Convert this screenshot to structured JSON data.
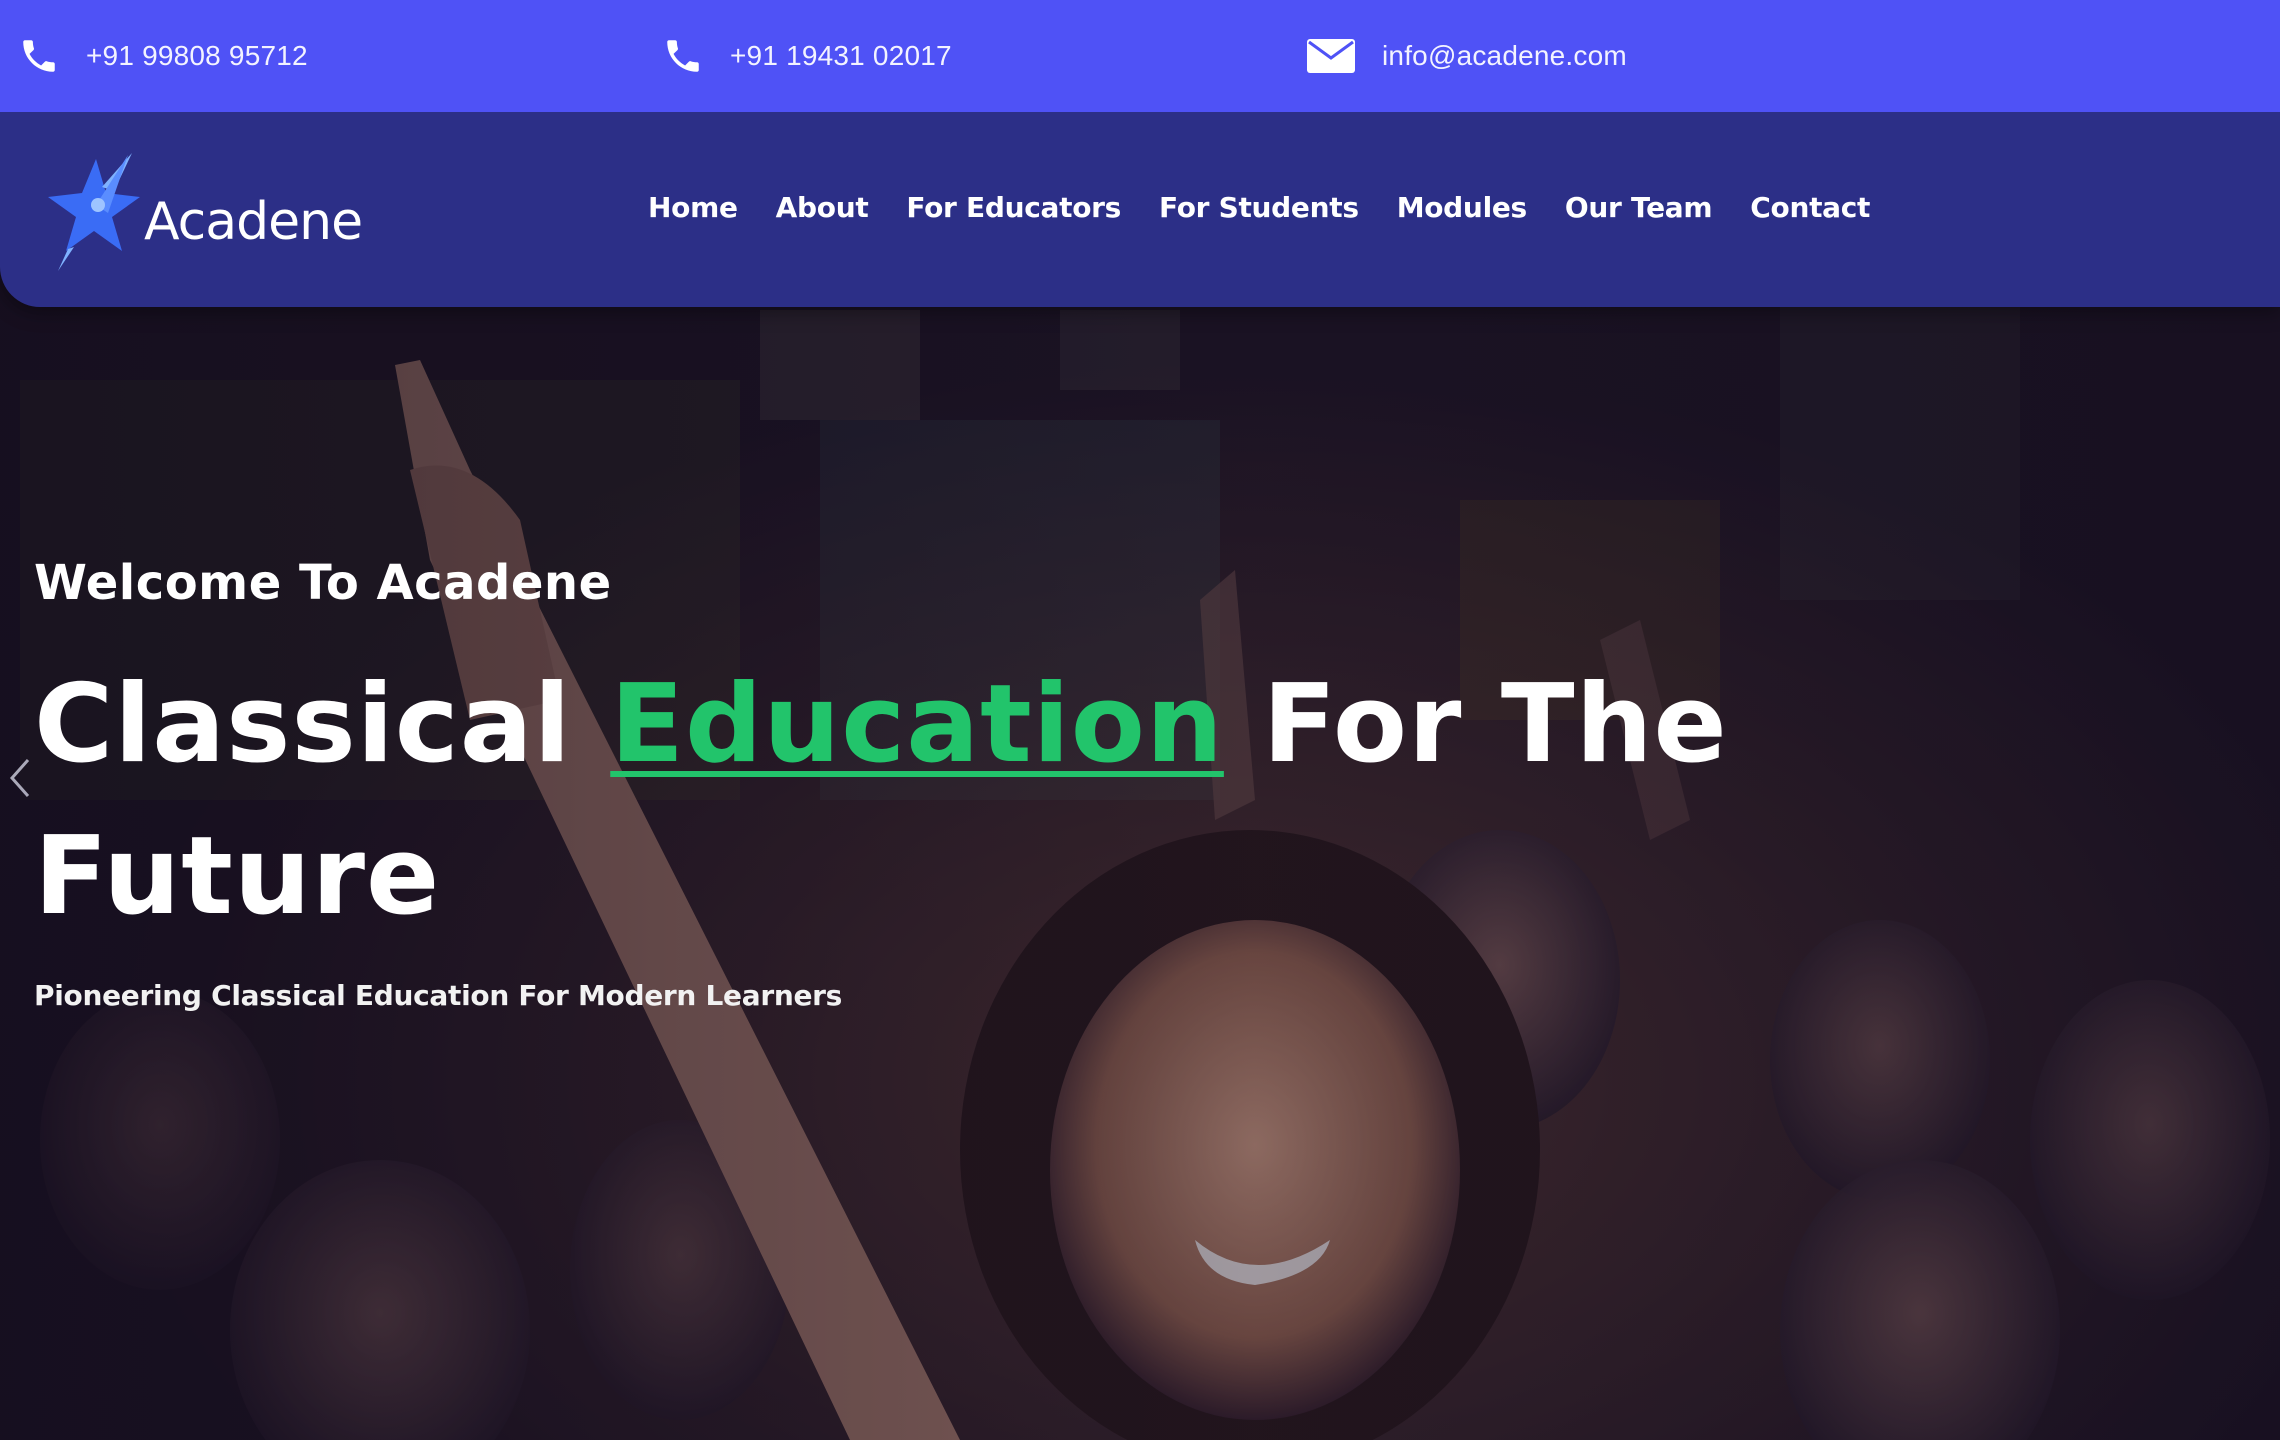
{
  "topbar": {
    "phone1": {
      "icon": "phone-icon",
      "text": "+91 99808 95712"
    },
    "phone2": {
      "icon": "phone-icon",
      "text": "+91 19431 02017"
    },
    "email": {
      "icon": "mail-icon",
      "text": "info@acadene.com"
    }
  },
  "brand": {
    "name": "Acadene",
    "logo_icon": "rocket-star-icon"
  },
  "nav": {
    "items": [
      "Home",
      "About",
      "For Educators",
      "For Students",
      "Modules",
      "Our Team",
      "Contact"
    ]
  },
  "hero": {
    "welcome": "Welcome To Acadene",
    "title_before": "Classical ",
    "title_accent": "Education",
    "title_after": " For The Future",
    "subtitle": "Pioneering Classical Education For Modern Learners",
    "prev_icon": "chevron-left-icon"
  },
  "colors": {
    "topbar_bg": "#4f52f6",
    "navbar_bg": "#2c2f87",
    "accent_green": "#22c46b",
    "text_white": "#ffffff"
  }
}
